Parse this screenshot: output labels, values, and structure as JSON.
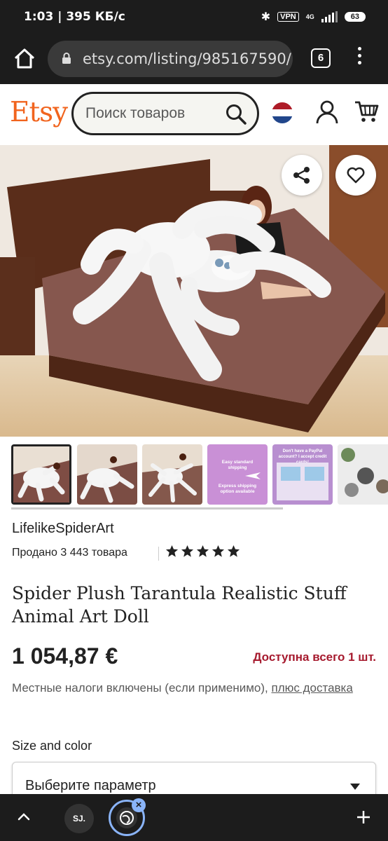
{
  "statusbar": {
    "time_speed": "1:03 | 395 КБ/с",
    "vpn": "VPN",
    "net": "4G",
    "battery": "63"
  },
  "browser": {
    "url": "etsy.com/listing/985167590/",
    "tab_count": "6"
  },
  "header": {
    "logo": "Etsy",
    "search_placeholder": "Поиск товаров"
  },
  "listing": {
    "shop_name": "LifelikeSpiderArt",
    "sales": "Продано 3 443 товара",
    "rating": 5,
    "title": "Spider Plush Tarantula Realistic Stuff Animal Art Doll",
    "price": "1 054,87 €",
    "stock": "Доступна всего 1 шт.",
    "taxes_text": "Местные налоги включены (если применимо),",
    "taxes_link": "плюс доставка",
    "option_label": "Size and color",
    "option_value": "Выберите параметр"
  },
  "thumbnails": {
    "promo1_line1": "Easy standard shipping",
    "promo1_line2": "Express shipping option available",
    "promo2_line1": "Don't have a PayPal account? I accept credit cards!"
  },
  "bottombar": {
    "tab1_label": "SJ."
  },
  "colors": {
    "etsy_orange": "#f1641e",
    "stock_red": "#a61a2e",
    "chrome_dark": "#1c1c1c",
    "accent_blue": "#8ab4f8"
  }
}
